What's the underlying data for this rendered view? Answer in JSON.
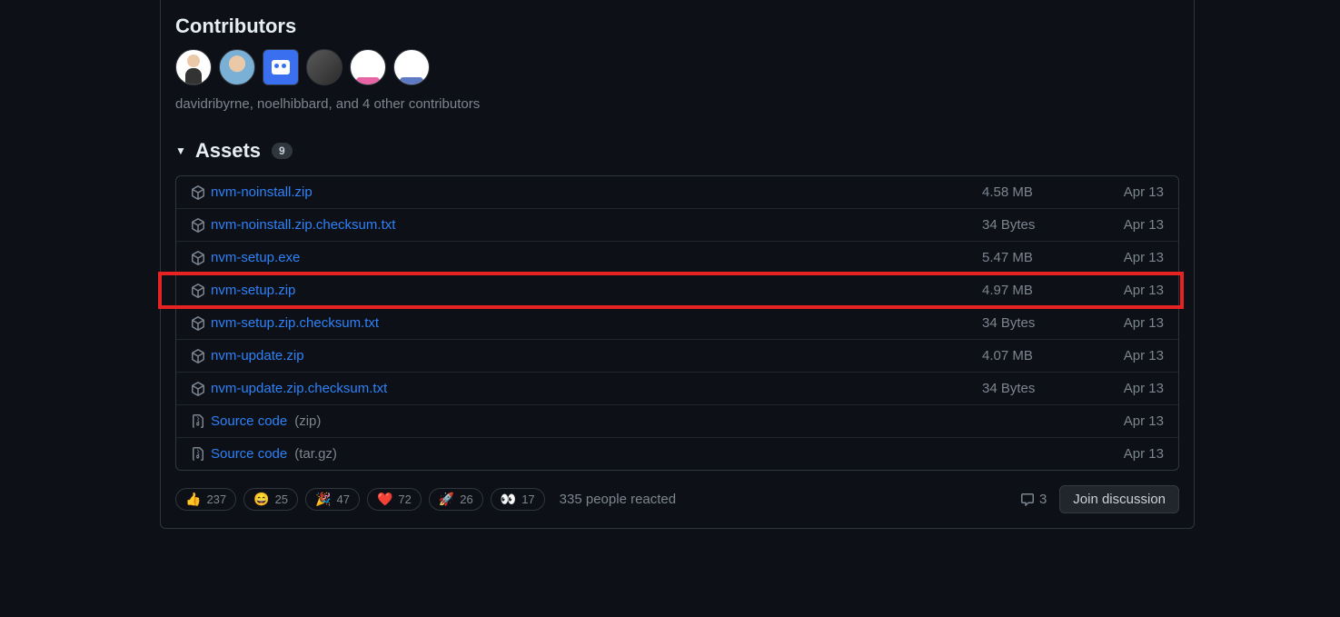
{
  "contributors": {
    "title": "Contributors",
    "summary": "davidribyrne, noelhibbard, and 4 other contributors"
  },
  "assets": {
    "title": "Assets",
    "count": "9",
    "rows": [
      {
        "name": "nvm-noinstall.zip",
        "sub": "",
        "size": "4.58 MB",
        "date": "Apr 13",
        "icon": "pkg",
        "highlight": false
      },
      {
        "name": "nvm-noinstall.zip.checksum.txt",
        "sub": "",
        "size": "34 Bytes",
        "date": "Apr 13",
        "icon": "pkg",
        "highlight": false
      },
      {
        "name": "nvm-setup.exe",
        "sub": "",
        "size": "5.47 MB",
        "date": "Apr 13",
        "icon": "pkg",
        "highlight": false
      },
      {
        "name": "nvm-setup.zip",
        "sub": "",
        "size": "4.97 MB",
        "date": "Apr 13",
        "icon": "pkg",
        "highlight": true
      },
      {
        "name": "nvm-setup.zip.checksum.txt",
        "sub": "",
        "size": "34 Bytes",
        "date": "Apr 13",
        "icon": "pkg",
        "highlight": false
      },
      {
        "name": "nvm-update.zip",
        "sub": "",
        "size": "4.07 MB",
        "date": "Apr 13",
        "icon": "pkg",
        "highlight": false
      },
      {
        "name": "nvm-update.zip.checksum.txt",
        "sub": "",
        "size": "34 Bytes",
        "date": "Apr 13",
        "icon": "pkg",
        "highlight": false
      },
      {
        "name": "Source code",
        "sub": "(zip)",
        "size": "",
        "date": "Apr 13",
        "icon": "zip",
        "highlight": false
      },
      {
        "name": "Source code",
        "sub": "(tar.gz)",
        "size": "",
        "date": "Apr 13",
        "icon": "zip",
        "highlight": false
      }
    ]
  },
  "reactions": [
    {
      "emoji": "👍",
      "count": "237"
    },
    {
      "emoji": "😄",
      "count": "25"
    },
    {
      "emoji": "🎉",
      "count": "47"
    },
    {
      "emoji": "❤️",
      "count": "72"
    },
    {
      "emoji": "🚀",
      "count": "26"
    },
    {
      "emoji": "👀",
      "count": "17"
    }
  ],
  "reacted_text": "335 people reacted",
  "comments": {
    "count": "3"
  },
  "join_label": "Join discussion"
}
